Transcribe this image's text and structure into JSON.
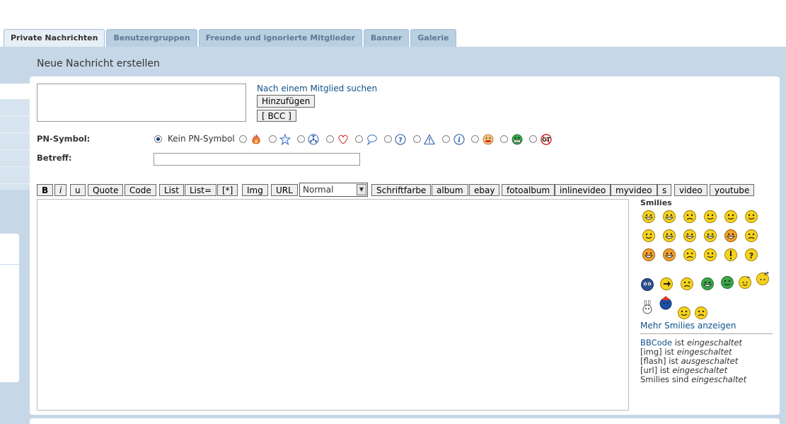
{
  "tabs": [
    "Private Nachrichten",
    "Benutzergruppen",
    "Freunde und ignorierte Mitglieder",
    "Banner",
    "Galerie"
  ],
  "page_title": "Neue Nachricht erstellen",
  "recipients": {
    "search_link": "Nach einem Mitglied suchen",
    "add_button": "Hinzufügen",
    "bcc_button": "[ BCC ]"
  },
  "pm_symbol": {
    "label": "PN-Symbol:",
    "none_label": "Kein PN-Symbol",
    "icons": [
      "fire-icon",
      "star-icon",
      "radioactive-icon",
      "heart-icon",
      "speech-bubble-icon",
      "question-icon",
      "warning-icon",
      "info-icon",
      "mad-face-icon",
      "grin-face-icon",
      "offtopic-icon"
    ],
    "colors": {
      "star": "#3f6ec4",
      "heart": "#d23a3a",
      "info": "#2b5ea8"
    }
  },
  "subject": {
    "label": "Betreff:",
    "value": ""
  },
  "toolbar": {
    "bold": "B",
    "italic": "i",
    "underline": "u",
    "quote": "Quote",
    "code": "Code",
    "list": "List",
    "list_eq": "List=",
    "list_item": "[*]",
    "img": "Img",
    "url": "URL",
    "font_size": "Normal",
    "font_color": "Schriftfarbe",
    "album": "album",
    "ebay": "ebay",
    "fotoalbum": "fotoalbum",
    "inlinevideo": "inlinevideo",
    "myvideo": "myvideo",
    "s": "s",
    "video": "video",
    "youtube": "youtube"
  },
  "message": {
    "value": ""
  },
  "smilies": {
    "title": "Smilies",
    "icons": [
      "biggrin",
      "grin",
      "sad",
      "eek",
      "rolleyes",
      "smile",
      "cool",
      "lol",
      "mad",
      "razz",
      "redface",
      "confused",
      "evil",
      "twisted",
      "neutral",
      "wink",
      "exclaim",
      "question",
      "hypno",
      "arrow",
      "hmm",
      "teeth",
      "alien",
      "bomb",
      "bubble",
      "bunny",
      "santa",
      "happy",
      "meh"
    ],
    "more_link": "Mehr Smilies anzeigen"
  },
  "status": {
    "bbcode_link": "BBCode",
    "bbcode_text": "ist",
    "bbcode_state": "eingeschaltet",
    "img_tag": "[img]",
    "img_text": "ist",
    "img_state": "eingeschaltet",
    "flash_tag": "[flash]",
    "flash_text": "ist",
    "flash_state": "ausgeschaltet",
    "url_tag": "[url]",
    "url_text": "ist",
    "url_state": "eingeschaltet",
    "smilies_tag": "Smilies",
    "smilies_text": "sind",
    "smilies_state": "eingeschaltet"
  }
}
